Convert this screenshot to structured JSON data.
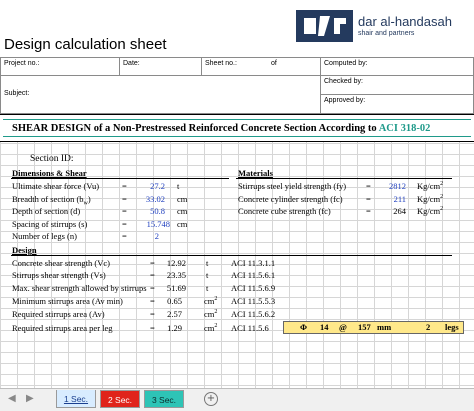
{
  "document": {
    "title": "Design calculation sheet",
    "logo": {
      "name": "dar al-handasah",
      "sub": "shair and partners"
    }
  },
  "header": {
    "project_no": "Project no.:",
    "date": "Date:",
    "sheet_no": "Sheet no.:",
    "of": "of",
    "computed_by": "Computed by:",
    "checked_by": "Checked by:",
    "approved_by": "Approved by:",
    "subject": "Subject:"
  },
  "banner": {
    "text": "SHEAR DESIGN of a Non-Prestressed Reinforced Concrete Section According to ",
    "code": "ACI 318-02"
  },
  "section_id_label": "Section ID:",
  "dimensions": {
    "heading": "Dimensions & Shear",
    "rows": [
      {
        "label": "Ultimate shear force (Vu)",
        "eq": "=",
        "value": "27.2",
        "unit": "t"
      },
      {
        "label": "Breadth of section (bw)",
        "eq": "=",
        "value": "33.02",
        "unit": "cm"
      },
      {
        "label": "Depth of section (d)",
        "eq": "=",
        "value": "50.8",
        "unit": "cm"
      },
      {
        "label": "Spacing of stirrups (s)",
        "eq": "=",
        "value": "15.748",
        "unit": "cm"
      },
      {
        "label": "Number of legs (n)",
        "eq": "=",
        "value": "2",
        "unit": ""
      }
    ]
  },
  "materials": {
    "heading": "Materials",
    "rows": [
      {
        "label": "Stirrups steel yield strength (fy)",
        "eq": "=",
        "value": "2812",
        "unit": "Kg/cm²"
      },
      {
        "label": "Concrete cylinder strength (fc)",
        "eq": "=",
        "value": "211",
        "unit": "Kg/cm²"
      },
      {
        "label": "Concrete cube strength (fc)",
        "eq": "=",
        "value": "264",
        "unit": "Kg/cm²"
      }
    ]
  },
  "design": {
    "heading": "Design",
    "rows": [
      {
        "label": "Concrete shear strength  (Vc)",
        "eq": "=",
        "value": "12.92",
        "unit": "t",
        "ref": "ACI 11.3.1.1"
      },
      {
        "label": "Stirrups shear strength  (Vs)",
        "eq": "=",
        "value": "23.35",
        "unit": "t",
        "ref": "ACI 11.5.6.1"
      },
      {
        "label": "Max. shear strength allowed by stirrups",
        "eq": "=",
        "value": "51.69",
        "unit": "t",
        "ref": "ACI 11.5.6.9"
      },
      {
        "label": "Minimum stirrups area (Av min)",
        "eq": "=",
        "value": "0.65",
        "unit": "cm²",
        "ref": "ACI 11.5.5.3"
      },
      {
        "label": "Required stirrups area  (Av)",
        "eq": "=",
        "value": "2.57",
        "unit": "cm²",
        "ref": "ACI 11.5.6.2"
      },
      {
        "label": "Required stirrups area per leg",
        "eq": "=",
        "value": "1.29",
        "unit": "cm²",
        "ref": "ACI 11.5.6"
      }
    ]
  },
  "result": {
    "phi": "Φ",
    "dia": "14",
    "at": "@",
    "spacing": "157",
    "mm": "mm",
    "legs_count": "2",
    "legs": "legs"
  },
  "tabs": [
    {
      "label": "1 Sec.",
      "color": "#d8ecff",
      "active": true
    },
    {
      "label": "2 Sec.",
      "color": "#e0241b",
      "active": false
    },
    {
      "label": "3 Sec.",
      "color": "#2ec4b6",
      "active": false
    }
  ],
  "colors": {
    "accent": "#243a5e",
    "value_blue": "#1f3fbf",
    "banner_teal": "#1f9a8a",
    "highlight": "#ffe88a"
  }
}
